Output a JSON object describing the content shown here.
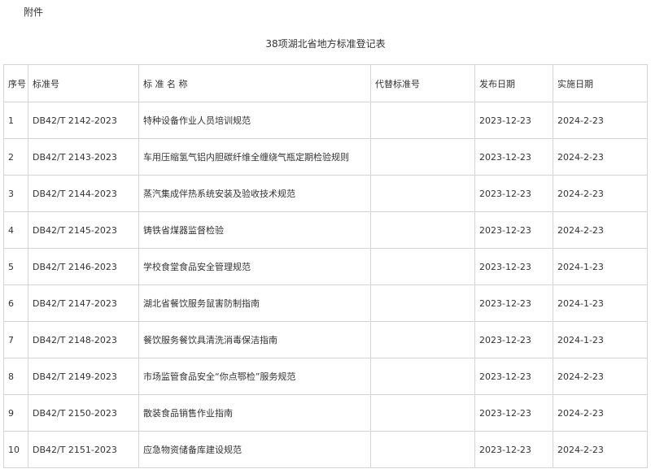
{
  "attachment_label": "附件",
  "document_title": "38项湖北省地方标准登记表",
  "table": {
    "headers": {
      "seq": "序号",
      "code": "标准号",
      "name": "标 准 名 称",
      "replaces": "代替标准号",
      "publish_date": "发布日期",
      "implement_date": "实施日期"
    },
    "rows": [
      {
        "seq": "1",
        "code": "DB42/T 2142-2023",
        "name": "特种设备作业人员培训规范",
        "replaces": "",
        "publish_date": "2023-12-23",
        "implement_date": "2024-2-23"
      },
      {
        "seq": "2",
        "code": "DB42/T 2143-2023",
        "name": "车用压缩氢气铝内胆碳纤维全缠绕气瓶定期检验规则",
        "replaces": "",
        "publish_date": "2023-12-23",
        "implement_date": "2024-2-23"
      },
      {
        "seq": "3",
        "code": "DB42/T 2144-2023",
        "name": "蒸汽集成伴热系统安装及验收技术规范",
        "replaces": "",
        "publish_date": "2023-12-23",
        "implement_date": "2024-2-23"
      },
      {
        "seq": "4",
        "code": "DB42/T 2145-2023",
        "name": "铸铁省煤器监督检验",
        "replaces": "",
        "publish_date": "2023-12-23",
        "implement_date": "2024-2-23"
      },
      {
        "seq": "5",
        "code": "DB42/T 2146-2023",
        "name": "学校食堂食品安全管理规范",
        "replaces": "",
        "publish_date": "2023-12-23",
        "implement_date": "2024-1-23"
      },
      {
        "seq": "6",
        "code": "DB42/T 2147-2023",
        "name": "湖北省餐饮服务鼠害防制指南",
        "replaces": "",
        "publish_date": "2023-12-23",
        "implement_date": "2024-1-23"
      },
      {
        "seq": "7",
        "code": "DB42/T 2148-2023",
        "name": "餐饮服务餐饮具清洗消毒保洁指南",
        "replaces": "",
        "publish_date": "2023-12-23",
        "implement_date": "2024-1-23"
      },
      {
        "seq": "8",
        "code": "DB42/T 2149-2023",
        "name": "市场监管食品安全“你点鄂检”服务规范",
        "replaces": "",
        "publish_date": "2023-12-23",
        "implement_date": "2024-2-23"
      },
      {
        "seq": "9",
        "code": "DB42/T 2150-2023",
        "name": "散装食品销售作业指南",
        "replaces": "",
        "publish_date": "2023-12-23",
        "implement_date": "2024-2-23"
      },
      {
        "seq": "10",
        "code": "DB42/T 2151-2023",
        "name": "应急物资储备库建设规范",
        "replaces": "",
        "publish_date": "2023-12-23",
        "implement_date": "2024-2-23"
      }
    ]
  }
}
